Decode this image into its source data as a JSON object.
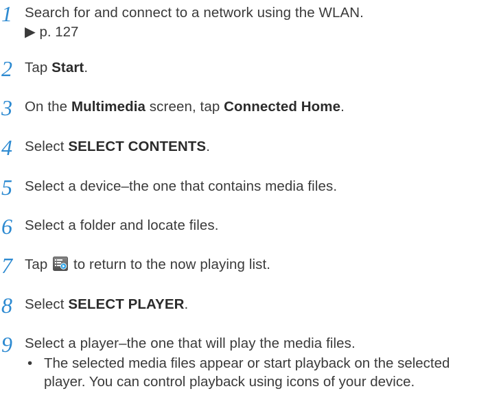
{
  "steps": [
    {
      "num": "1",
      "pre": "Search for and connect to a network using the WLAN.",
      "ref": "▶ p. 127"
    },
    {
      "num": "2",
      "pre": "Tap ",
      "b1": "Start",
      "post": "."
    },
    {
      "num": "3",
      "pre": "On the ",
      "b1": "Multimedia",
      "mid": " screen, tap ",
      "b2": "Connected Home",
      "post": "."
    },
    {
      "num": "4",
      "pre": "Select ",
      "b1": "SELECT CONTENTS",
      "post": "."
    },
    {
      "num": "5",
      "pre": "Select a device–the one that contains media files."
    },
    {
      "num": "6",
      "pre": "Select a folder and locate files."
    },
    {
      "num": "7",
      "pre": "Tap ",
      "icon": "now-playing-list-icon",
      "post": " to return to the now playing list."
    },
    {
      "num": "8",
      "pre": "Select ",
      "b1": "SELECT PLAYER",
      "post": "."
    },
    {
      "num": "9",
      "pre": "Select a player–the one that will play the media files.",
      "bullet": "The selected media files appear or start playback on the selected player. You can control playback using icons of your device."
    }
  ],
  "colors": {
    "step_number": "#2d8ad1",
    "text": "#3a3a3a"
  }
}
